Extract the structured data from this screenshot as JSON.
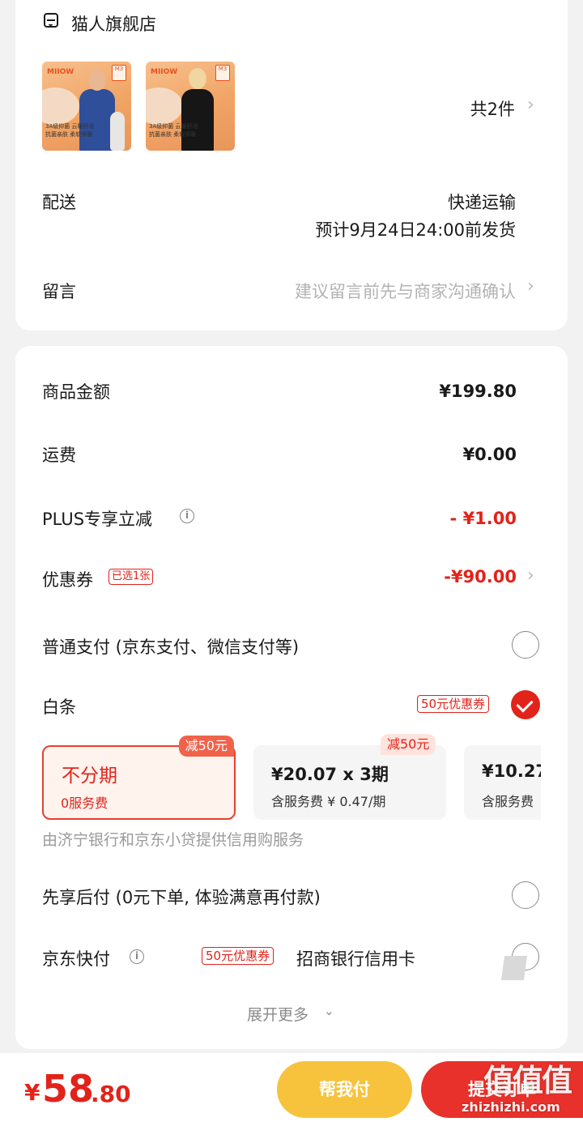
{
  "store": {
    "name": "猫人旗舰店",
    "item_count": "共2件",
    "products": [
      {
        "brand": "MIIOW",
        "size_tag": "M3",
        "caption": "3A级抑菌 云暖舒适",
        "caption2": "抗菌亲肤 柔软保暖",
        "banner": "秋冬打底"
      },
      {
        "brand": "MIIOW",
        "size_tag": "M3",
        "caption": "3A级抑菌 云暖舒适",
        "caption2": "抗菌亲肤 柔软保暖",
        "banner": "秋冬打底"
      }
    ]
  },
  "delivery": {
    "label": "配送",
    "method": "快递运输",
    "estimate": "预计9月24日24:00前发货"
  },
  "message": {
    "label": "留言",
    "placeholder": "建议留言前先与商家沟通确认"
  },
  "summary": {
    "goods_label": "商品金额",
    "goods_value": "¥199.80",
    "shipping_label": "运费",
    "shipping_value": "¥0.00",
    "plus_label": "PLUS专享立减",
    "plus_value": "- ¥1.00",
    "coupon_label": "优惠券",
    "coupon_badge": "已选1张",
    "coupon_value": "-¥90.00"
  },
  "payment": {
    "normal_label": "普通支付 (京东支付、微信支付等)",
    "baitiao_label": "白条",
    "baitiao_badge": "50元优惠券",
    "plans": [
      {
        "title": "不分期",
        "subtitle": "0服务费",
        "tag": "减50元"
      },
      {
        "title": "¥20.07 x 3期",
        "subtitle": "含服务费 ¥ 0.47/期",
        "tag": "减50元"
      },
      {
        "title": "¥10.27",
        "subtitle": "含服务费"
      }
    ],
    "credit_note": "由济宁银行和京东小贷提供信用购服务",
    "paylater_label": "先享后付 (0元下单, 体验满意再付款)",
    "quickpay_label": "京东快付",
    "quickpay_badge": "50元优惠券",
    "quickpay_bank": "招商银行信用卡",
    "expand_label": "展开更多"
  },
  "bottom": {
    "currency": "¥",
    "price_int": "58",
    "price_dec": ".80",
    "help_pay": "帮我付",
    "submit": "提交订单"
  },
  "watermark": {
    "logo": "值值值",
    "domain": "zhizhizhi.com"
  },
  "colors": {
    "accent_red": "#e2231a",
    "help_pay_yellow": "#f7c23c",
    "page_bg": "#f2f2f2"
  }
}
